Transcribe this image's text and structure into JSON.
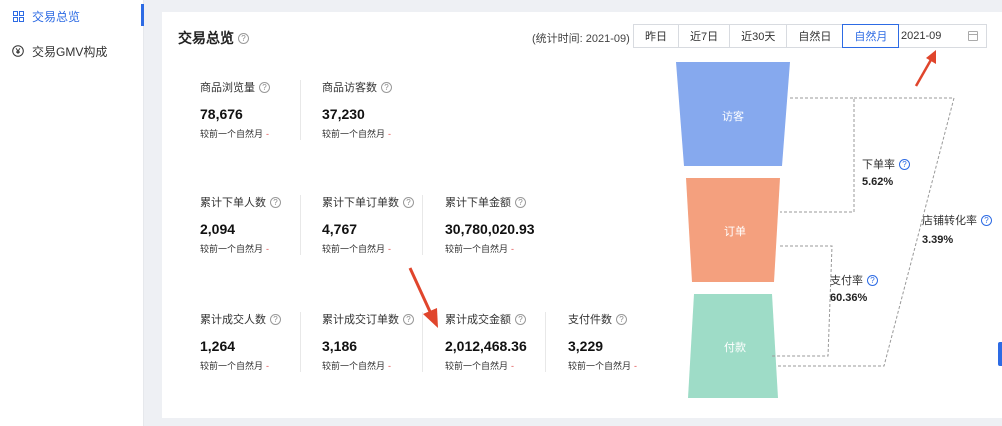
{
  "sidebar": {
    "items": [
      {
        "label": "交易总览",
        "icon": "grid-icon"
      },
      {
        "label": "交易GMV构成",
        "icon": "yuan-icon"
      }
    ]
  },
  "card": {
    "title": "交易总览",
    "stat_time": "(统计时间: 2021-09)",
    "ranges": [
      "昨日",
      "近7日",
      "近30天",
      "自然日",
      "自然月"
    ],
    "active_range": "自然月",
    "month_value": "2021-09"
  },
  "metrics": {
    "browse": {
      "label": "商品浏览量",
      "value": "78,676",
      "cmp": "较前一个自然月",
      "delta": "-"
    },
    "visitors": {
      "label": "商品访客数",
      "value": "37,230",
      "cmp": "较前一个自然月",
      "delta": "-"
    },
    "order_people": {
      "label": "累计下单人数",
      "value": "2,094",
      "cmp": "较前一个自然月",
      "delta": "-"
    },
    "order_count": {
      "label": "累计下单订单数",
      "value": "4,767",
      "cmp": "较前一个自然月",
      "delta": "-"
    },
    "order_amount": {
      "label": "累计下单金额",
      "value": "30,780,020.93",
      "cmp": "较前一个自然月",
      "delta": "-"
    },
    "deal_people": {
      "label": "累计成交人数",
      "value": "1,264",
      "cmp": "较前一个自然月",
      "delta": "-"
    },
    "deal_orders": {
      "label": "累计成交订单数",
      "value": "3,186",
      "cmp": "较前一个自然月",
      "delta": "-"
    },
    "deal_amount": {
      "label": "累计成交金额",
      "value": "2,012,468.36",
      "cmp": "较前一个自然月",
      "delta": "-"
    },
    "pay_items": {
      "label": "支付件数",
      "value": "3,229",
      "cmp": "较前一个自然月",
      "delta": "-"
    }
  },
  "funnel": {
    "stages": [
      {
        "label": "访客",
        "color": "#86a9ee"
      },
      {
        "label": "订单",
        "color": "#f4a07e"
      },
      {
        "label": "付款",
        "color": "#9edcc7"
      }
    ],
    "order_rate": {
      "label": "下单率",
      "value": "5.62%"
    },
    "pay_rate": {
      "label": "支付率",
      "value": "60.36%"
    },
    "store_rate": {
      "label": "店铺转化率",
      "value": "3.39%"
    }
  },
  "colors": {
    "accent": "#2d6be4",
    "arrow": "#e0452c",
    "negative": "#e05050"
  }
}
